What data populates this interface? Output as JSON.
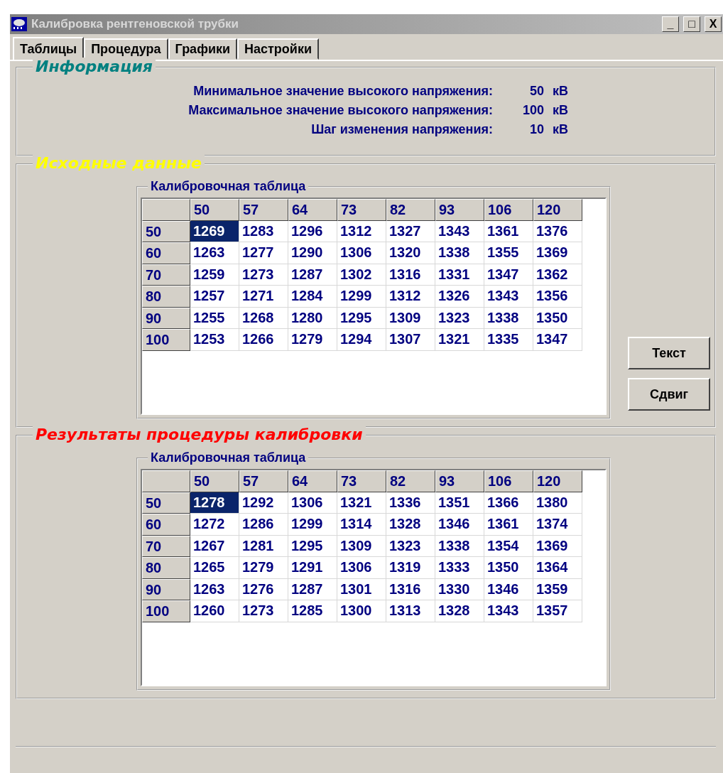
{
  "window": {
    "title": "Калибровка рентгеновской трубки",
    "controls": [
      "_",
      "□",
      "X"
    ]
  },
  "tabs": [
    {
      "label": "Таблицы",
      "selected": true
    },
    {
      "label": "Процедура",
      "selected": false
    },
    {
      "label": "Графики",
      "selected": false
    },
    {
      "label": "Настройки",
      "selected": false
    }
  ],
  "info": {
    "title": "Информация",
    "rows": [
      {
        "label": "Минимальное значение высокого напряжения:",
        "value": "50",
        "unit": "кВ"
      },
      {
        "label": "Максимальное значение высокого напряжения:",
        "value": "100",
        "unit": "кВ"
      },
      {
        "label": "Шаг изменения напряжения:",
        "value": "10",
        "unit": "кВ"
      }
    ]
  },
  "source": {
    "title": "Исходные данные",
    "table": {
      "title": "Калибровочная таблица",
      "columns": [
        "50",
        "57",
        "64",
        "73",
        "82",
        "93",
        "106",
        "120"
      ],
      "rows": [
        {
          "header": "50",
          "cells": [
            {
              "text": "1269",
              "selected": true
            },
            {
              "text": "1283",
              "selected": false
            },
            {
              "text": "1296",
              "selected": false
            },
            {
              "text": "1312",
              "selected": false
            },
            {
              "text": "1327",
              "selected": false
            },
            {
              "text": "1343",
              "selected": false
            },
            {
              "text": "1361",
              "selected": false
            },
            {
              "text": "1376",
              "selected": false
            }
          ]
        },
        {
          "header": "60",
          "cells": [
            {
              "text": "1263",
              "selected": false
            },
            {
              "text": "1277",
              "selected": false
            },
            {
              "text": "1290",
              "selected": false
            },
            {
              "text": "1306",
              "selected": false
            },
            {
              "text": "1320",
              "selected": false
            },
            {
              "text": "1338",
              "selected": false
            },
            {
              "text": "1355",
              "selected": false
            },
            {
              "text": "1369",
              "selected": false
            }
          ]
        },
        {
          "header": "70",
          "cells": [
            {
              "text": "1259",
              "selected": false
            },
            {
              "text": "1273",
              "selected": false
            },
            {
              "text": "1287",
              "selected": false
            },
            {
              "text": "1302",
              "selected": false
            },
            {
              "text": "1316",
              "selected": false
            },
            {
              "text": "1331",
              "selected": false
            },
            {
              "text": "1347",
              "selected": false
            },
            {
              "text": "1362",
              "selected": false
            }
          ]
        },
        {
          "header": "80",
          "cells": [
            {
              "text": "1257",
              "selected": false
            },
            {
              "text": "1271",
              "selected": false
            },
            {
              "text": "1284",
              "selected": false
            },
            {
              "text": "1299",
              "selected": false
            },
            {
              "text": "1312",
              "selected": false
            },
            {
              "text": "1326",
              "selected": false
            },
            {
              "text": "1343",
              "selected": false
            },
            {
              "text": "1356",
              "selected": false
            }
          ]
        },
        {
          "header": "90",
          "cells": [
            {
              "text": "1255",
              "selected": false
            },
            {
              "text": "1268",
              "selected": false
            },
            {
              "text": "1280",
              "selected": false
            },
            {
              "text": "1295",
              "selected": false
            },
            {
              "text": "1309",
              "selected": false
            },
            {
              "text": "1323",
              "selected": false
            },
            {
              "text": "1338",
              "selected": false
            },
            {
              "text": "1350",
              "selected": false
            }
          ]
        },
        {
          "header": "100",
          "cells": [
            {
              "text": "1253",
              "selected": false
            },
            {
              "text": "1266",
              "selected": false
            },
            {
              "text": "1279",
              "selected": false
            },
            {
              "text": "1294",
              "selected": false
            },
            {
              "text": "1307",
              "selected": false
            },
            {
              "text": "1321",
              "selected": false
            },
            {
              "text": "1335",
              "selected": false
            },
            {
              "text": "1347",
              "selected": false
            }
          ]
        }
      ]
    },
    "buttons": [
      "Текст",
      "Сдвиг"
    ]
  },
  "results": {
    "title": "Результаты процедуры калибровки",
    "table": {
      "title": "Калибровочная таблица",
      "columns": [
        "50",
        "57",
        "64",
        "73",
        "82",
        "93",
        "106",
        "120"
      ],
      "rows": [
        {
          "header": "50",
          "cells": [
            {
              "text": "1278",
              "selected": true
            },
            {
              "text": "1292",
              "selected": false
            },
            {
              "text": "1306",
              "selected": false
            },
            {
              "text": "1321",
              "selected": false
            },
            {
              "text": "1336",
              "selected": false
            },
            {
              "text": "1351",
              "selected": false
            },
            {
              "text": "1366",
              "selected": false
            },
            {
              "text": "1380",
              "selected": false
            }
          ]
        },
        {
          "header": "60",
          "cells": [
            {
              "text": "1272",
              "selected": false
            },
            {
              "text": "1286",
              "selected": false
            },
            {
              "text": "1299",
              "selected": false
            },
            {
              "text": "1314",
              "selected": false
            },
            {
              "text": "1328",
              "selected": false
            },
            {
              "text": "1346",
              "selected": false
            },
            {
              "text": "1361",
              "selected": false
            },
            {
              "text": "1374",
              "selected": false
            }
          ]
        },
        {
          "header": "70",
          "cells": [
            {
              "text": "1267",
              "selected": false
            },
            {
              "text": "1281",
              "selected": false
            },
            {
              "text": "1295",
              "selected": false
            },
            {
              "text": "1309",
              "selected": false
            },
            {
              "text": "1323",
              "selected": false
            },
            {
              "text": "1338",
              "selected": false
            },
            {
              "text": "1354",
              "selected": false
            },
            {
              "text": "1369",
              "selected": false
            }
          ]
        },
        {
          "header": "80",
          "cells": [
            {
              "text": "1265",
              "selected": false
            },
            {
              "text": "1279",
              "selected": false
            },
            {
              "text": "1291",
              "selected": false
            },
            {
              "text": "1306",
              "selected": false
            },
            {
              "text": "1319",
              "selected": false
            },
            {
              "text": "1333",
              "selected": false
            },
            {
              "text": "1350",
              "selected": false
            },
            {
              "text": "1364",
              "selected": false
            }
          ]
        },
        {
          "header": "90",
          "cells": [
            {
              "text": "1263",
              "selected": false
            },
            {
              "text": "1276",
              "selected": false
            },
            {
              "text": "1287",
              "selected": false
            },
            {
              "text": "1301",
              "selected": false
            },
            {
              "text": "1316",
              "selected": false
            },
            {
              "text": "1330",
              "selected": false
            },
            {
              "text": "1346",
              "selected": false
            },
            {
              "text": "1359",
              "selected": false
            }
          ]
        },
        {
          "header": "100",
          "cells": [
            {
              "text": "1260",
              "selected": false
            },
            {
              "text": "1273",
              "selected": false
            },
            {
              "text": "1285",
              "selected": false
            },
            {
              "text": "1300",
              "selected": false
            },
            {
              "text": "1313",
              "selected": false
            },
            {
              "text": "1328",
              "selected": false
            },
            {
              "text": "1343",
              "selected": false
            },
            {
              "text": "1357",
              "selected": false
            }
          ]
        }
      ]
    }
  }
}
